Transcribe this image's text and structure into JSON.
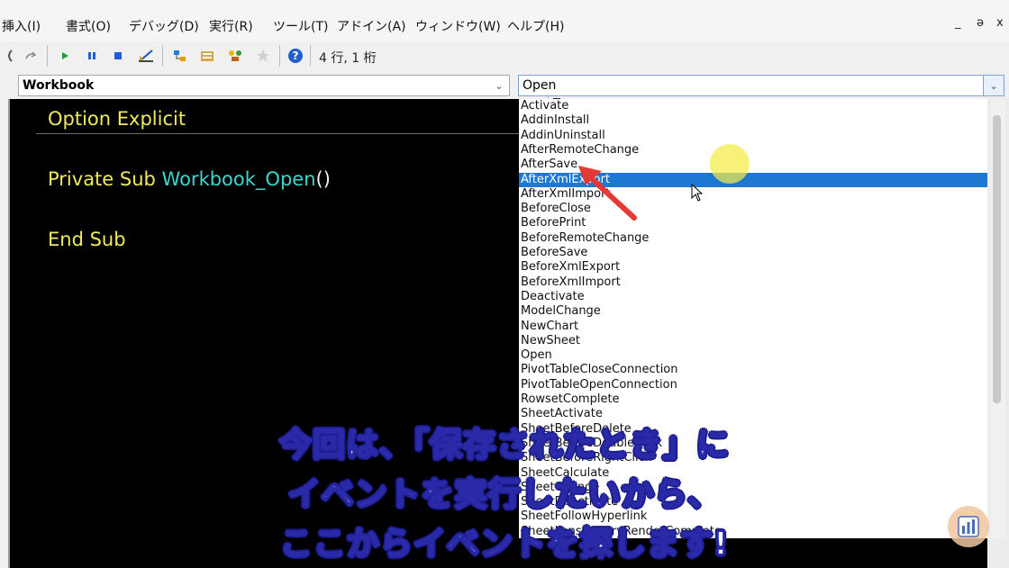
{
  "menu": {
    "items": [
      "挿入(I)",
      "書式(O)",
      "デバッグ(D)",
      "実行(R)",
      "ツール(T)",
      "アドイン(A)",
      "ウィンドウ(W)",
      "ヘルプ(H)"
    ],
    "window_controls": [
      "_",
      "ǝ",
      "x"
    ]
  },
  "toolbar": {
    "buttons": [
      {
        "icon": "undo-icon"
      },
      {
        "icon": "redo-icon"
      },
      {
        "icon": "run-icon"
      },
      {
        "icon": "pause-icon"
      },
      {
        "icon": "reset-icon"
      },
      {
        "icon": "design-mode-icon"
      },
      {
        "icon": "project-explorer-icon"
      },
      {
        "icon": "properties-icon"
      },
      {
        "icon": "object-browser-icon"
      },
      {
        "icon": "toolbox-icon"
      },
      {
        "icon": "help-icon"
      }
    ],
    "cursor_position": "4 行, 1 桁"
  },
  "object_combo": {
    "value": "Workbook"
  },
  "procedure_combo": {
    "value": "Open"
  },
  "code": {
    "line1": "Option Explicit",
    "line2_keyword": "Private Sub ",
    "line2_name": "Workbook_Open",
    "line2_parens": "()",
    "line3": "End Sub"
  },
  "event_list": {
    "selected": "AfterXmlExport",
    "items": [
      "Activate",
      "AddinInstall",
      "AddinUninstall",
      "AfterRemoteChange",
      "AfterSave",
      "AfterXmlExport",
      "AfterXmlImport",
      "BeforeClose",
      "BeforePrint",
      "BeforeRemoteChange",
      "BeforeSave",
      "BeforeXmlExport",
      "BeforeXmlImport",
      "Deactivate",
      "ModelChange",
      "NewChart",
      "NewSheet",
      "Open",
      "PivotTableCloseConnection",
      "PivotTableOpenConnection",
      "RowsetComplete",
      "SheetActivate",
      "SheetBeforeDelete",
      "SheetBeforeDoubleClick",
      "SheetBeforeRightClick",
      "SheetCalculate",
      "SheetChange",
      "SheetDeactivate",
      "SheetFollowHyperlink",
      "SheetLensGalleryRenderComplete"
    ]
  },
  "subtitle": {
    "line1": "今回は、「保存されたとき」に",
    "line2": "イベントを実行したいから、",
    "line3": "ここからイベントを探します!"
  },
  "colors": {
    "keyword": "#f1ea5c",
    "procedure_name": "#3dd6cf",
    "selection": "#1e78d2",
    "arrow": "#e53935",
    "subtitle_outline": "#1a1a8a"
  }
}
